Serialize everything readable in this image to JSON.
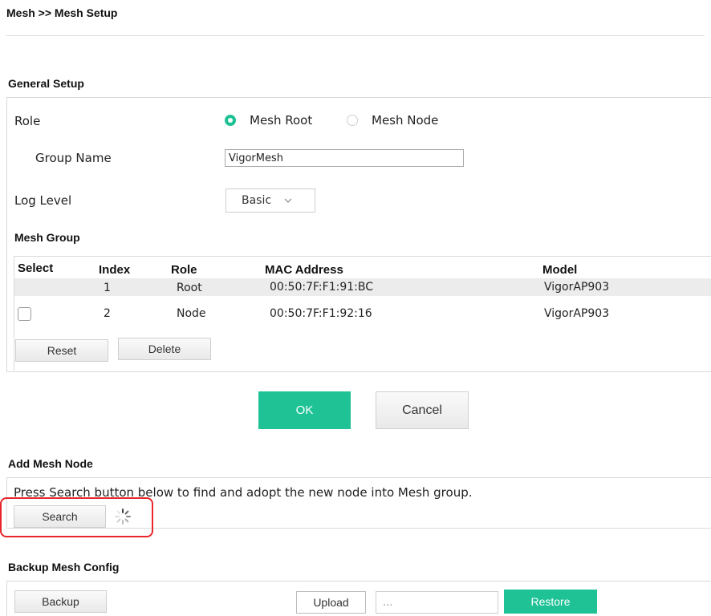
{
  "breadcrumb": "Mesh >> Mesh Setup",
  "general_setup": {
    "title": "General Setup",
    "role_label": "Role",
    "role_options": [
      "Mesh Root",
      "Mesh Node"
    ],
    "selected_role": "Mesh Root",
    "group_name_label": "Group Name",
    "group_name_value": "VigorMesh",
    "log_level_label": "Log Level",
    "log_level_value": "Basic",
    "mesh_group": {
      "title": "Mesh Group",
      "columns": [
        "Select",
        "Index",
        "Role",
        "MAC Address",
        "Model"
      ],
      "rows": [
        {
          "index": "1",
          "role": "Root",
          "mac": "00:50:7F:F1:91:BC",
          "model": "VigorAP903"
        },
        {
          "index": "2",
          "role": "Node",
          "mac": "00:50:7F:F1:92:16",
          "model": "VigorAP903"
        }
      ],
      "reset_label": "Reset",
      "delete_label": "Delete"
    }
  },
  "actions": {
    "ok_label": "OK",
    "cancel_label": "Cancel"
  },
  "add_mesh_node": {
    "title": "Add Mesh Node",
    "description": "Press Search button below to find and adopt the new node into Mesh group.",
    "search_label": "Search"
  },
  "backup_mesh_config": {
    "title": "Backup Mesh Config",
    "backup_label": "Backup",
    "upload_label": "Upload",
    "file_placeholder": "...",
    "restore_label": "Restore"
  },
  "colors": {
    "accent": "#1ec295",
    "highlight": "#e8262a"
  }
}
